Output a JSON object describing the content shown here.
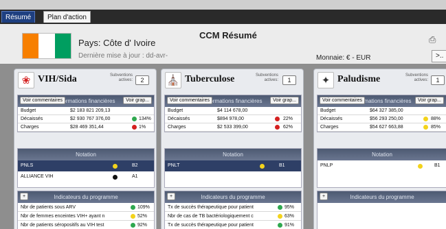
{
  "tabs": [
    {
      "label": "Résumé"
    },
    {
      "label": "Plan d'action"
    }
  ],
  "header": {
    "country": "Pays: Côte d' Ivoire",
    "updated": "Dernière mise à jour : dd-avr-",
    "title": "CCM Résumé",
    "currency": "Monnaie: € - EUR",
    "more_label": ">..",
    "flag_colors": [
      "#f77f00",
      "#ffffff",
      "#009e60"
    ],
    "print_icon": "printer-icon"
  },
  "common": {
    "comments_label": "Voir commentaires",
    "graph_label": "Voir grap...",
    "finance_title": "Informations financières",
    "notation_title": "Notation",
    "indicators_title": "Indicateurs du programme",
    "add_label": "+",
    "subsidies_label_1": "Subventions",
    "subsidies_label_2": "actives:",
    "row_labels": [
      "Budget",
      "Décaissés",
      "Charges"
    ]
  },
  "colors": {
    "green": "#2fa84f",
    "yellow": "#f3d31c",
    "red": "#d42020",
    "black": "#111111"
  },
  "panels": [
    {
      "name": "VIH/Sida",
      "icon": "ribbon-icon",
      "subsidies": "2",
      "finance": [
        {
          "value": "$2 183 821 209,13",
          "pct": "",
          "status": ""
        },
        {
          "value": "$2 930 767 376,00",
          "pct": "134%",
          "status": "green"
        },
        {
          "value": "$28 469 351,44",
          "pct": "1%",
          "status": "red"
        }
      ],
      "ratings": [
        {
          "label": "PNLS",
          "grade": "B2",
          "status": "yellow"
        },
        {
          "label": "ALLIANCE VIH",
          "grade": "A1",
          "status": "black"
        }
      ],
      "indicators": [
        {
          "label": "Nbr de patients sous ARV",
          "pct": "109%",
          "status": "green"
        },
        {
          "label": "Nbr de femmes enceintes VIH+ ayant n",
          "pct": "52%",
          "status": "yellow"
        },
        {
          "label": "Nbr de patients séropositifs au VIH test",
          "pct": "92%",
          "status": "green"
        }
      ]
    },
    {
      "name": "Tuberculose",
      "icon": "hospital-icon",
      "subsidies": "1",
      "finance": [
        {
          "value": "$4 114 678,00",
          "pct": "",
          "status": ""
        },
        {
          "value": "$894 978,00",
          "pct": "22%",
          "status": "red"
        },
        {
          "value": "$2 533 399,00",
          "pct": "62%",
          "status": "red"
        }
      ],
      "ratings": [
        {
          "label": "PNLT",
          "grade": "B1",
          "status": "yellow"
        }
      ],
      "indicators": [
        {
          "label": "Tx de succès thérapeutique pour patient",
          "pct": "95%",
          "status": "green"
        },
        {
          "label": "Nbr de cas de TB bactériologiquement c",
          "pct": "63%",
          "status": "yellow"
        },
        {
          "label": "Tx de succès thérapeutique pour patient",
          "pct": "91%",
          "status": "green"
        }
      ]
    },
    {
      "name": "Paludisme",
      "icon": "mosquito-icon",
      "subsidies": "1",
      "finance": [
        {
          "value": "$64 327 385,00",
          "pct": "",
          "status": ""
        },
        {
          "value": "$56 293 250,00",
          "pct": "88%",
          "status": "yellow"
        },
        {
          "value": "$54 627 663,88",
          "pct": "85%",
          "status": "yellow"
        }
      ],
      "ratings": [
        {
          "label": "PNLP",
          "grade": "B1",
          "status": "yellow"
        }
      ],
      "indicators": []
    }
  ]
}
